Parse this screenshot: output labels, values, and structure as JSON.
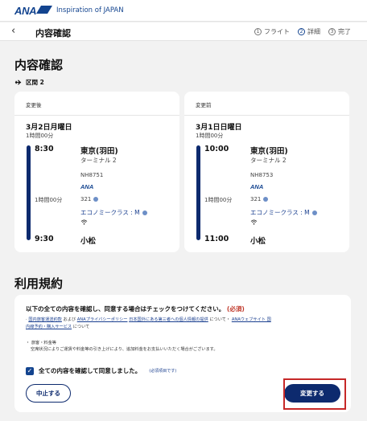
{
  "header": {
    "logo": "ANA",
    "tagline": "Inspiration of JAPAN"
  },
  "nav": {
    "back_icon": "chevron-left-icon",
    "title": "内容確認",
    "steps": [
      {
        "num": "1",
        "label": "フライト"
      },
      {
        "num": "2",
        "label": "詳細"
      },
      {
        "num": "3",
        "label": "完了"
      }
    ]
  },
  "page": {
    "title": "内容確認",
    "segment_icon": "plane-icon",
    "segment": "区間 2"
  },
  "cards": [
    {
      "tag": "変更後",
      "date": "3月2日月曜日",
      "duration": "1時間00分",
      "dep_time": "8:30",
      "arr_time": "9:30",
      "mid_duration": "1時間00分",
      "dep_city": "東京(羽田)",
      "terminal": "ターミナル 2",
      "flight_no": "NH8751",
      "airline": "ANA",
      "aircraft": "321",
      "cabin": "エコノミークラス : M",
      "wifi_icon": "wifi-icon",
      "arr_city": "小松"
    },
    {
      "tag": "変更前",
      "date": "3月1日日曜日",
      "duration": "1時間00分",
      "dep_time": "10:00",
      "arr_time": "11:00",
      "mid_duration": "1時間00分",
      "dep_city": "東京(羽田)",
      "terminal": "ターミナル 2",
      "flight_no": "NH8753",
      "airline": "ANA",
      "aircraft": "321",
      "cabin": "エコノミークラス : M",
      "wifi_icon": "wifi-icon",
      "arr_city": "小松"
    }
  ],
  "terms": {
    "title": "利用規約",
    "heading": "以下の全ての内容を確認し、同意する場合はチェックをつけてください。",
    "required": "(必須)",
    "link1": "国内旅客運送約款",
    "text1": "および",
    "link2": "ANAプライバシーポリシー",
    "link3": "日本国外にある第三者への個人情報の提供",
    "text2": "について・",
    "link4": "ANAウェブサイト 国",
    "link5": "内線予約・購入サービス",
    "text3": "について",
    "fee_title": "・ 旅客・料金等",
    "fee_text": "空席状況によりご運賃や料金等の引き上げにより、追加料金をお支払いいただく場合がございます。",
    "check_label": "全ての内容を確認して同意しました。",
    "check_note": "(必須項目です)"
  },
  "buttons": {
    "cancel": "中止する",
    "change": "変更する"
  }
}
